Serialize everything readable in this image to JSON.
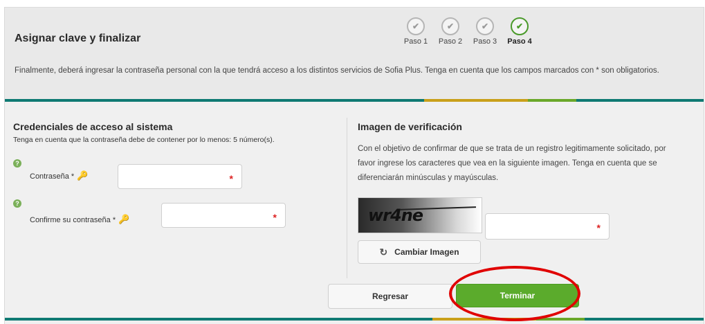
{
  "header": {
    "title": "Asignar clave y finalizar",
    "intro": "Finalmente, deberá ingresar la contraseña personal con la que tendrá acceso a los distintos servicios de Sofia Plus. Tenga en cuenta que los campos marcados con * son obligatorios."
  },
  "steps": [
    {
      "label": "Paso 1",
      "icon": "check-icon",
      "active": false
    },
    {
      "label": "Paso 2",
      "icon": "check-icon",
      "active": false
    },
    {
      "label": "Paso 3",
      "icon": "check-icon",
      "active": false
    },
    {
      "label": "Paso 4",
      "icon": "check-icon",
      "active": true
    }
  ],
  "credentials": {
    "title": "Credenciales de acceso al sistema",
    "note": "Tenga en cuenta que la contraseña debe de contener por lo menos: 5 número(s).",
    "password_label": "Contraseña *",
    "confirm_label": "Confirme su contraseña *",
    "required_mark": "*",
    "help_icon": "?",
    "key_icon": "🔑"
  },
  "verification": {
    "title": "Imagen de verificación",
    "description": "Con el objetivo de confirmar de que se trata de un registro legitimamente solicitado, por favor ingrese los caracteres que vea en la siguiente imagen. Tenga en cuenta que se diferenciarán minúsculas y mayúsculas.",
    "captcha_text": "wr4ne",
    "change_image_label": "Cambiar Imagen",
    "refresh_icon": "↻",
    "required_mark": "*"
  },
  "actions": {
    "back_label": "Regresar",
    "finish_label": "Terminar"
  },
  "colors": {
    "accent_teal": "#0f7a73",
    "accent_yellow": "#c9a01a",
    "accent_green": "#6aa82a",
    "button_green": "#5bab2c",
    "highlight_red": "#e00000"
  }
}
